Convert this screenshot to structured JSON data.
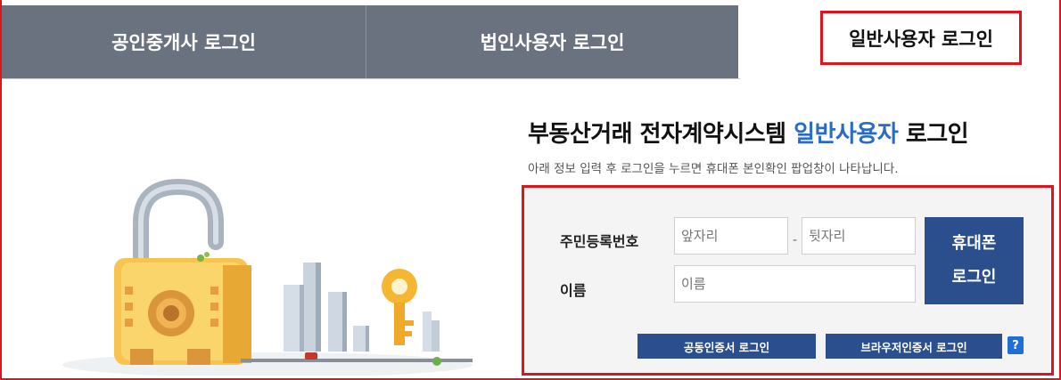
{
  "tabs": [
    {
      "label": "공인중개사 로그인",
      "active": false
    },
    {
      "label": "법인사용자 로그인",
      "active": false
    },
    {
      "label": "일반사용자 로그인",
      "active": true
    }
  ],
  "heading": {
    "prefix": "부동산거래 전자계약시스템 ",
    "highlight": "일반사용자",
    "suffix": " 로그인"
  },
  "subtitle": "아래 정보 입력 후 로그인을 누르면 휴대폰 본인확인 팝업창이 나타납니다.",
  "form": {
    "rrn_label": "주민등록번호",
    "rrn_front_placeholder": "앞자리",
    "rrn_separator": "-",
    "rrn_back_placeholder": "뒷자리",
    "name_label": "이름",
    "name_placeholder": "이름",
    "phone_login_line1": "휴대폰",
    "phone_login_line2": "로그인",
    "public_cert_label": "공동인증서 로그인",
    "browser_cert_label": "브라우저인증서 로그인",
    "help_label": "?"
  },
  "colors": {
    "tab_inactive": "#6a7280",
    "highlight_blue": "#2a6bc7",
    "button_navy": "#2a4f8c",
    "annotation_red": "#e0141c"
  }
}
